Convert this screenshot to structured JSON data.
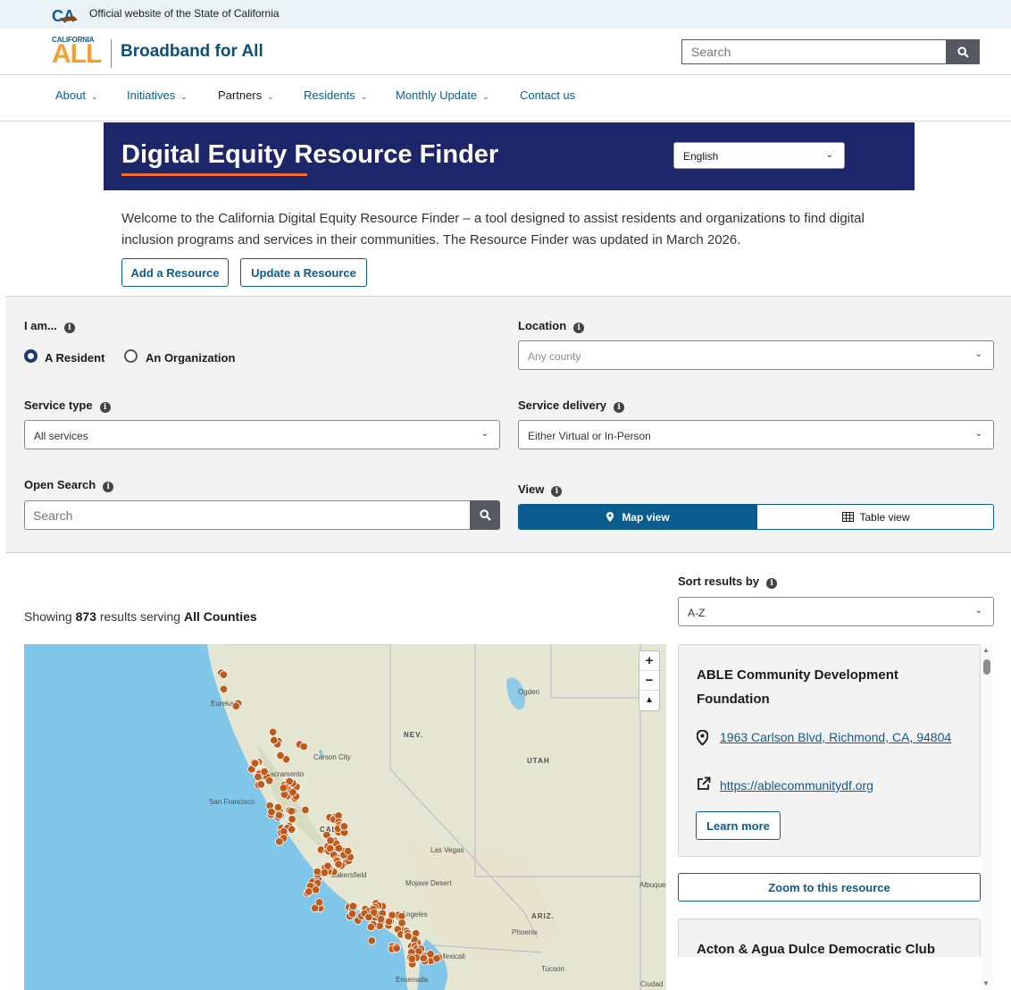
{
  "official_bar": {
    "text": "Official website of the State of California"
  },
  "header": {
    "logo_small": "CALIFORNIA",
    "logo_big": "ALL",
    "site_title": "Broadband for All",
    "search_placeholder": "Search"
  },
  "nav": {
    "items": [
      {
        "label": "About",
        "active": false
      },
      {
        "label": "Initiatives",
        "active": false
      },
      {
        "label": "Partners",
        "active": true
      },
      {
        "label": "Residents",
        "active": false
      },
      {
        "label": "Monthly Update",
        "active": false
      },
      {
        "label": "Contact us",
        "active": false
      }
    ]
  },
  "hero": {
    "title_underlined": "Digital Equity",
    "title_rest": " Resource Finder",
    "language": "English"
  },
  "intro": "Welcome to the California Digital Equity Resource Finder – a tool designed to assist residents and organizations to find digital inclusion programs and services in their communities. The Resource Finder was updated in March 2026.",
  "buttons": {
    "add": "Add a Resource",
    "update": "Update a Resource"
  },
  "filters": {
    "i_am_label": "I am...",
    "resident": "A Resident",
    "organization": "An Organization",
    "selected_role": "A Resident",
    "location_label": "Location",
    "location_value": "Any county",
    "service_type_label": "Service type",
    "service_type_value": "All services",
    "service_delivery_label": "Service delivery",
    "service_delivery_value": "Either Virtual or In-Person",
    "open_search_label": "Open Search",
    "open_search_placeholder": "Search",
    "view_label": "View",
    "map_view": "Map view",
    "table_view": "Table view",
    "active_view": "Map view"
  },
  "results": {
    "prefix": "Showing ",
    "count": "873",
    "middle": " results serving ",
    "scope": "All Counties",
    "sort_label": "Sort results by",
    "sort_value": "A-Z"
  },
  "map": {
    "labels": [
      "Eureka",
      "NEV.",
      "Carson City",
      "Sacramento",
      "San Francisco",
      "UTAH",
      "Ogden",
      "CALIF.",
      "Las Vegas",
      "Bakersfield",
      "Mojave Desert",
      "Albuquerque",
      "ARIZ.",
      "Phoenix",
      "Los Angeles",
      "Mexicali",
      "Tucson",
      "Ensenada",
      "Ciudad"
    ],
    "marker_color": "#c05a1a",
    "water_color": "#7fc6e8"
  },
  "cards": [
    {
      "title": "ABLE Community Development Foundation",
      "address": "1963 Carlson Blvd, Richmond, CA, 94804",
      "url": "https://ablecommunitydf.org",
      "learn_more": "Learn more",
      "zoom": "Zoom to this resource"
    },
    {
      "title": "Acton & Agua Dulce Democratic Club"
    }
  ]
}
